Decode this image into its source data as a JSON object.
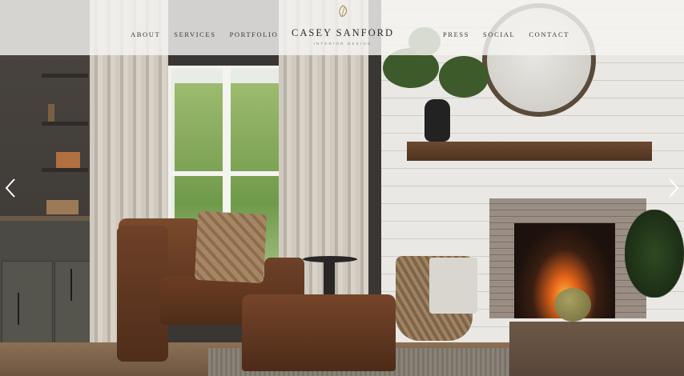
{
  "header": {
    "brand_name": "CASEY SANFORD",
    "brand_tagline": "INTERIOR DESIGN",
    "logo_icon": "leaf-crest-icon",
    "nav_left": [
      "ABOUT",
      "SERVICES",
      "PORTFOLIO"
    ],
    "nav_right": [
      "PRESS",
      "SOCIAL",
      "CONTACT"
    ]
  },
  "carousel": {
    "prev_icon": "chevron-left-icon",
    "next_icon": "chevron-right-icon"
  },
  "colors": {
    "header_bg": "#f5f4f1",
    "nav_text": "#3a3734",
    "logo_accent": "#a88b52"
  }
}
